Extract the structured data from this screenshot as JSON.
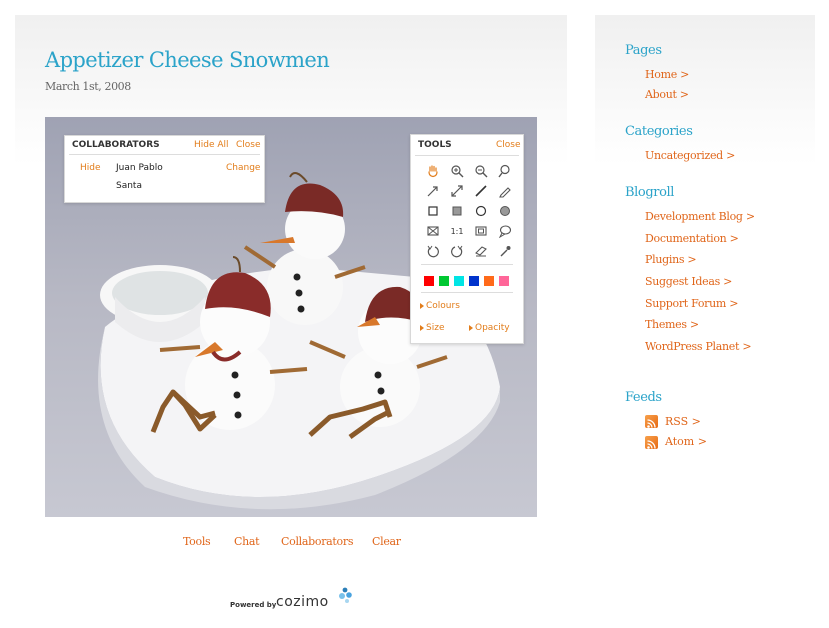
{
  "post": {
    "title": "Appetizer Cheese Snowmen",
    "date": "March 1st, 2008"
  },
  "collaborators": {
    "title": "COLLABORATORS",
    "hide_all": "Hide All",
    "close": "Close",
    "hide": "Hide",
    "name": "Juan Pablo Santa",
    "change": "Change"
  },
  "tools": {
    "title": "TOOLS",
    "close": "Close",
    "icons": [
      "hand-icon",
      "zoom-in-icon",
      "zoom-out-icon",
      "zoom-icon",
      "arrow-icon",
      "double-arrow-icon",
      "line-icon",
      "pencil-icon",
      "square-outline-icon",
      "square-filled-icon",
      "circle-outline-icon",
      "circle-filled-icon",
      "fit-icon",
      "actual-size-icon",
      "frame-icon",
      "speech-bubble-icon",
      "rotate-left-icon",
      "rotate-right-icon",
      "eraser-icon",
      "eyedropper-icon"
    ],
    "one_to_one": "1:1",
    "colors": [
      "#ff0000",
      "#00c832",
      "#00e5e5",
      "#0033cc",
      "#ff6a1a",
      "#ff6699"
    ],
    "colours_label": "Colours",
    "size_label": "Size",
    "opacity_label": "Opacity"
  },
  "nav": {
    "tools": "Tools",
    "chat": "Chat",
    "collaborators": "Collaborators",
    "clear": "Clear"
  },
  "footer": {
    "powered_by": "Powered by",
    "brand": "cozimo"
  },
  "sidebar": {
    "pages_heading": "Pages",
    "pages": [
      "Home >",
      "About >"
    ],
    "categories_heading": "Categories",
    "categories": [
      "Uncategorized >"
    ],
    "blogroll_heading": "Blogroll",
    "blogroll": [
      "Development Blog >",
      "Documentation >",
      "Plugins >",
      "Suggest Ideas >",
      "Support Forum >",
      "Themes >",
      "WordPress Planet >"
    ],
    "feeds_heading": "Feeds",
    "feeds": [
      "RSS >",
      "Atom >"
    ]
  },
  "colors": {
    "accent_blue": "#2ba3c9",
    "link_orange": "#e0661b",
    "ui_orange": "#e27d1b"
  }
}
